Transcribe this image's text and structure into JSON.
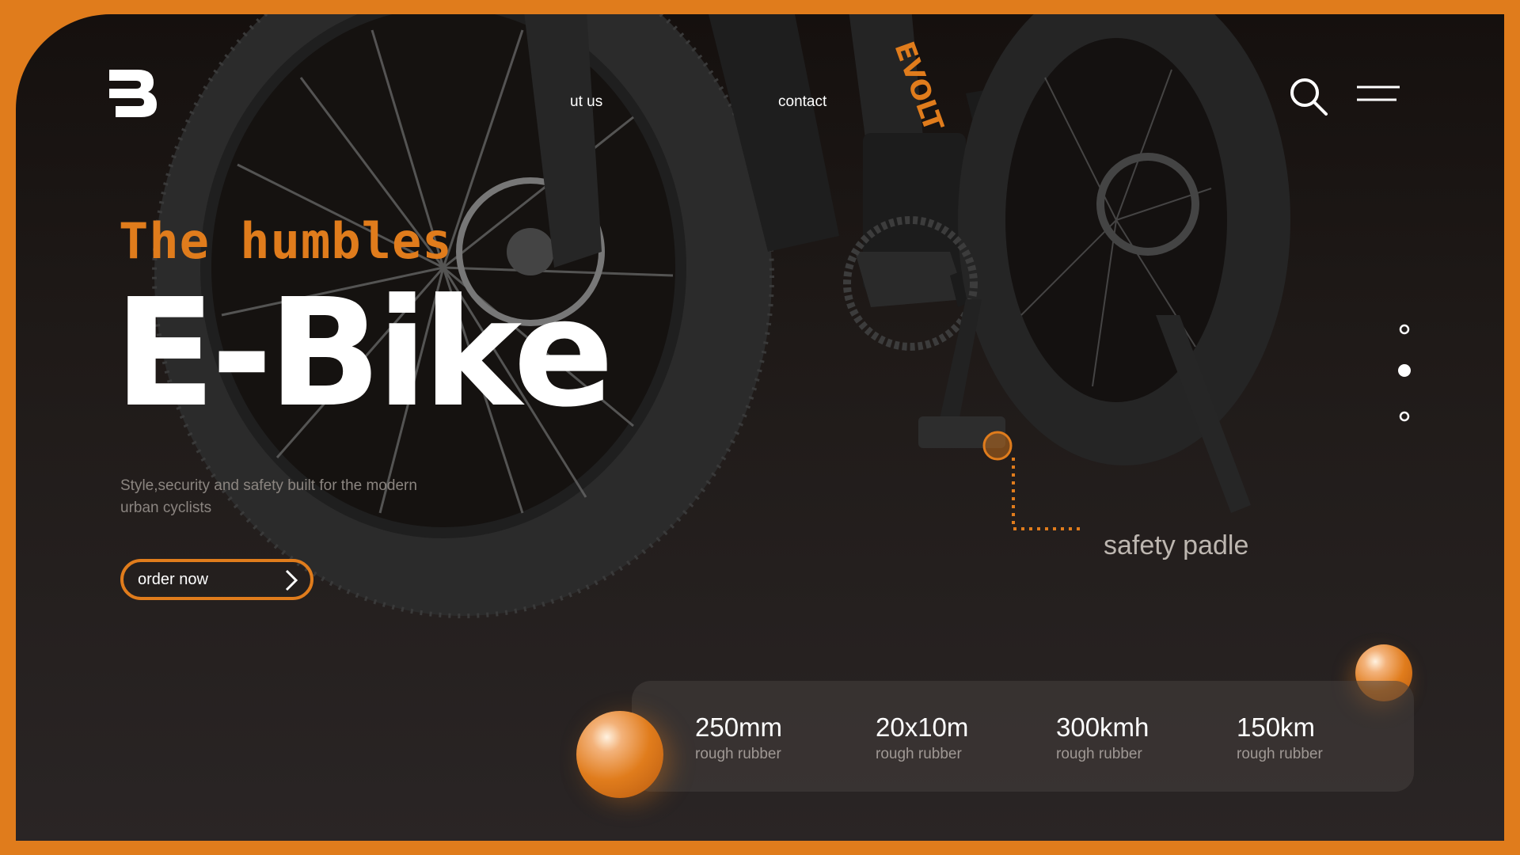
{
  "brand": {
    "logo_icon": "b-logo-icon"
  },
  "nav": {
    "about_label": "ut us",
    "contact_label": "contact",
    "search_icon": "search-icon",
    "menu_icon": "hamburger-menu-icon"
  },
  "hero": {
    "eyebrow": "The humbles",
    "title": "E-Bike",
    "tagline": "Style,security and safety built for the modern urban cyclists",
    "order_label": "order now"
  },
  "callout": {
    "label": "safety padle"
  },
  "slider": {
    "dot_count": 3,
    "active_index": 1
  },
  "stats": [
    {
      "value": "250mm",
      "label": "rough rubber"
    },
    {
      "value": "20x10m",
      "label": "rough rubber"
    },
    {
      "value": "300kmh",
      "label": "rough rubber"
    },
    {
      "value": "150km",
      "label": "rough rubber"
    }
  ],
  "colors": {
    "accent": "#e07c1c",
    "background": "#1a1513",
    "text": "#ffffff"
  }
}
